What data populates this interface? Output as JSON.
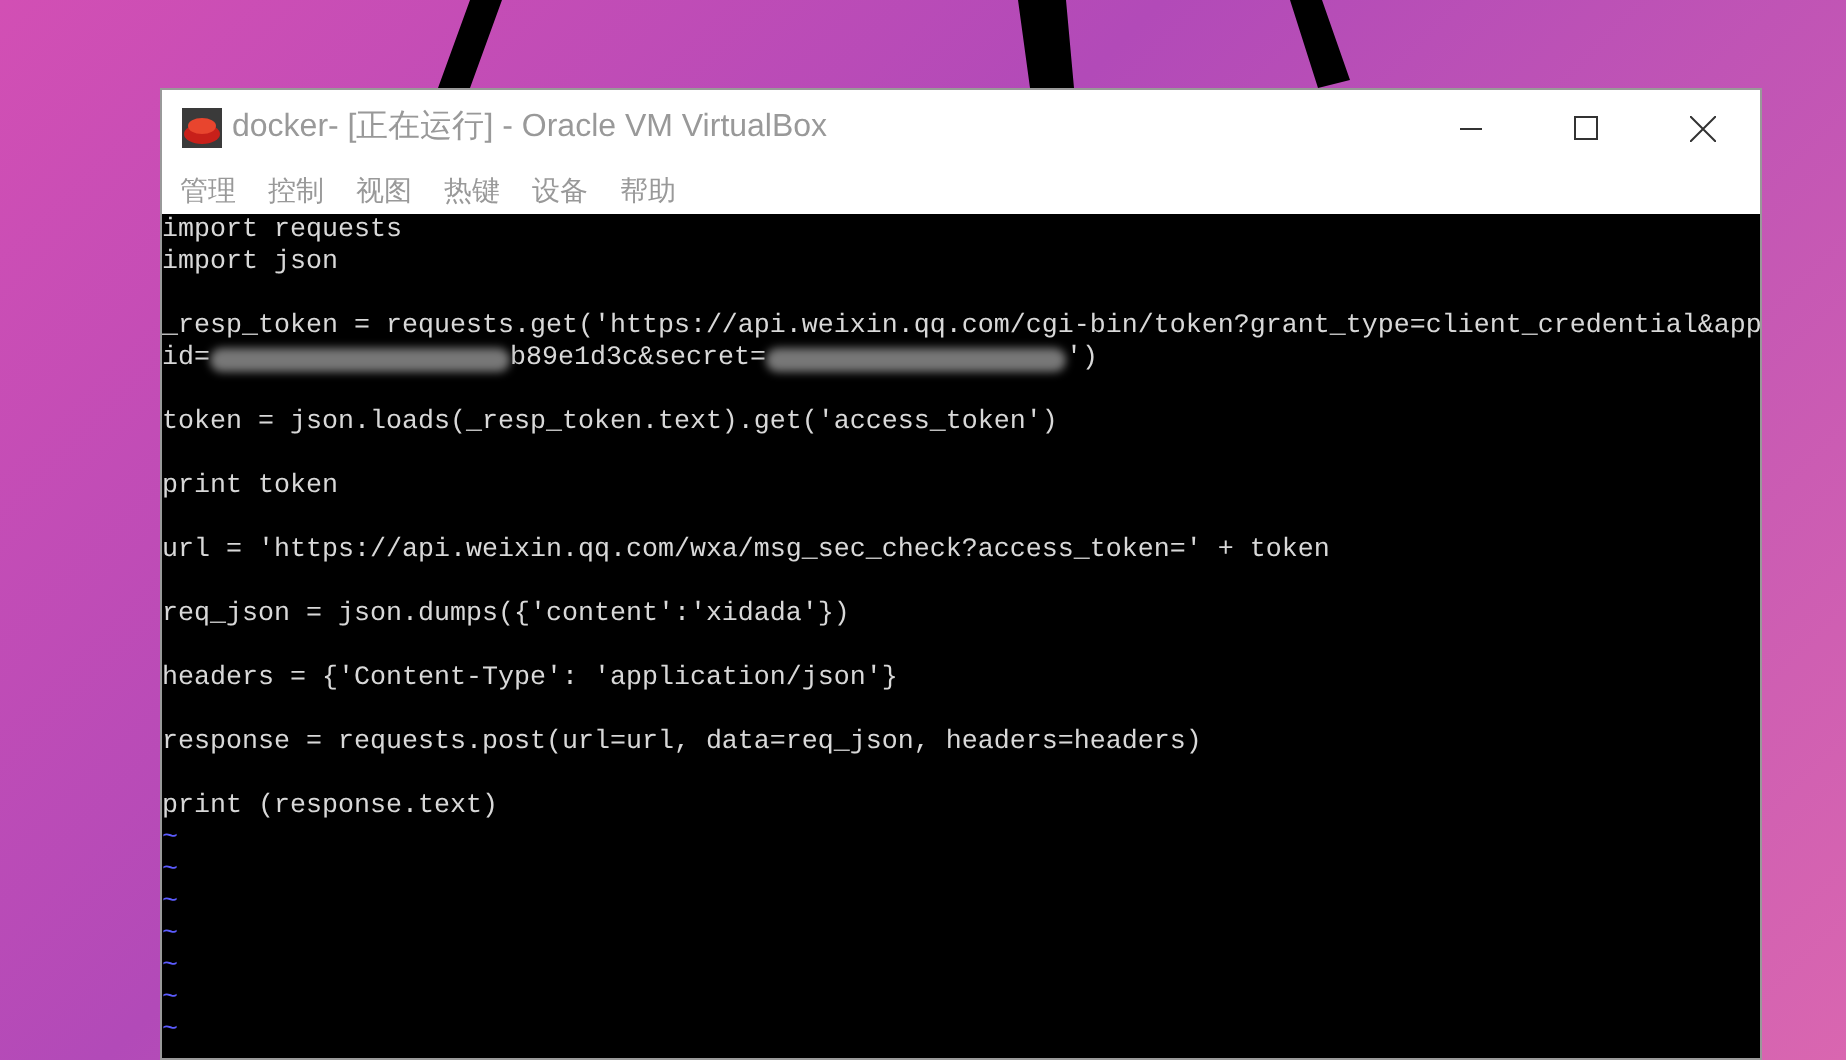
{
  "window": {
    "title": "docker- [正在运行] - Oracle VM VirtualBox"
  },
  "menu": [
    "管理",
    "控制",
    "视图",
    "热键",
    "设备",
    "帮助"
  ],
  "terminal": {
    "lines": [
      {
        "kind": "code",
        "segments": [
          {
            "kind": "text",
            "text": "import requests"
          }
        ]
      },
      {
        "kind": "code",
        "segments": [
          {
            "kind": "text",
            "text": "import json"
          }
        ]
      },
      {
        "kind": "blank"
      },
      {
        "kind": "code",
        "segments": [
          {
            "kind": "text",
            "text": "_resp_token = requests.get('https://api.weixin.qq.com/cgi-bin/token?grant_type=client_credential&app"
          }
        ]
      },
      {
        "kind": "code",
        "segments": [
          {
            "kind": "text",
            "text": "id="
          },
          {
            "kind": "redacted"
          },
          {
            "kind": "text",
            "text": "b89e1d3c&secret="
          },
          {
            "kind": "redacted"
          },
          {
            "kind": "text",
            "text": "')"
          }
        ]
      },
      {
        "kind": "blank"
      },
      {
        "kind": "code",
        "segments": [
          {
            "kind": "text",
            "text": "token = json.loads(_resp_token.text).get('access_token')"
          }
        ]
      },
      {
        "kind": "blank"
      },
      {
        "kind": "code",
        "segments": [
          {
            "kind": "text",
            "text": "print token"
          }
        ]
      },
      {
        "kind": "blank"
      },
      {
        "kind": "code",
        "segments": [
          {
            "kind": "text",
            "text": "url = 'https://api.weixin.qq.com/wxa/msg_sec_check?access_token=' + token"
          }
        ]
      },
      {
        "kind": "blank"
      },
      {
        "kind": "code",
        "segments": [
          {
            "kind": "text",
            "text": "req_json = json.dumps({'content':'xidada'})"
          }
        ]
      },
      {
        "kind": "blank"
      },
      {
        "kind": "code",
        "segments": [
          {
            "kind": "text",
            "text": "headers = {'Content-Type': 'application/json'}"
          }
        ]
      },
      {
        "kind": "blank"
      },
      {
        "kind": "code",
        "segments": [
          {
            "kind": "text",
            "text": "response = requests.post(url=url, data=req_json, headers=headers)"
          }
        ]
      },
      {
        "kind": "blank"
      },
      {
        "kind": "code",
        "segments": [
          {
            "kind": "text",
            "text": "print (response.text)"
          }
        ]
      },
      {
        "kind": "tilde",
        "text": "~"
      },
      {
        "kind": "tilde",
        "text": "~"
      },
      {
        "kind": "tilde",
        "text": "~"
      },
      {
        "kind": "tilde",
        "text": "~"
      },
      {
        "kind": "tilde",
        "text": "~"
      },
      {
        "kind": "tilde",
        "text": "~"
      },
      {
        "kind": "tilde",
        "text": "~"
      }
    ]
  }
}
